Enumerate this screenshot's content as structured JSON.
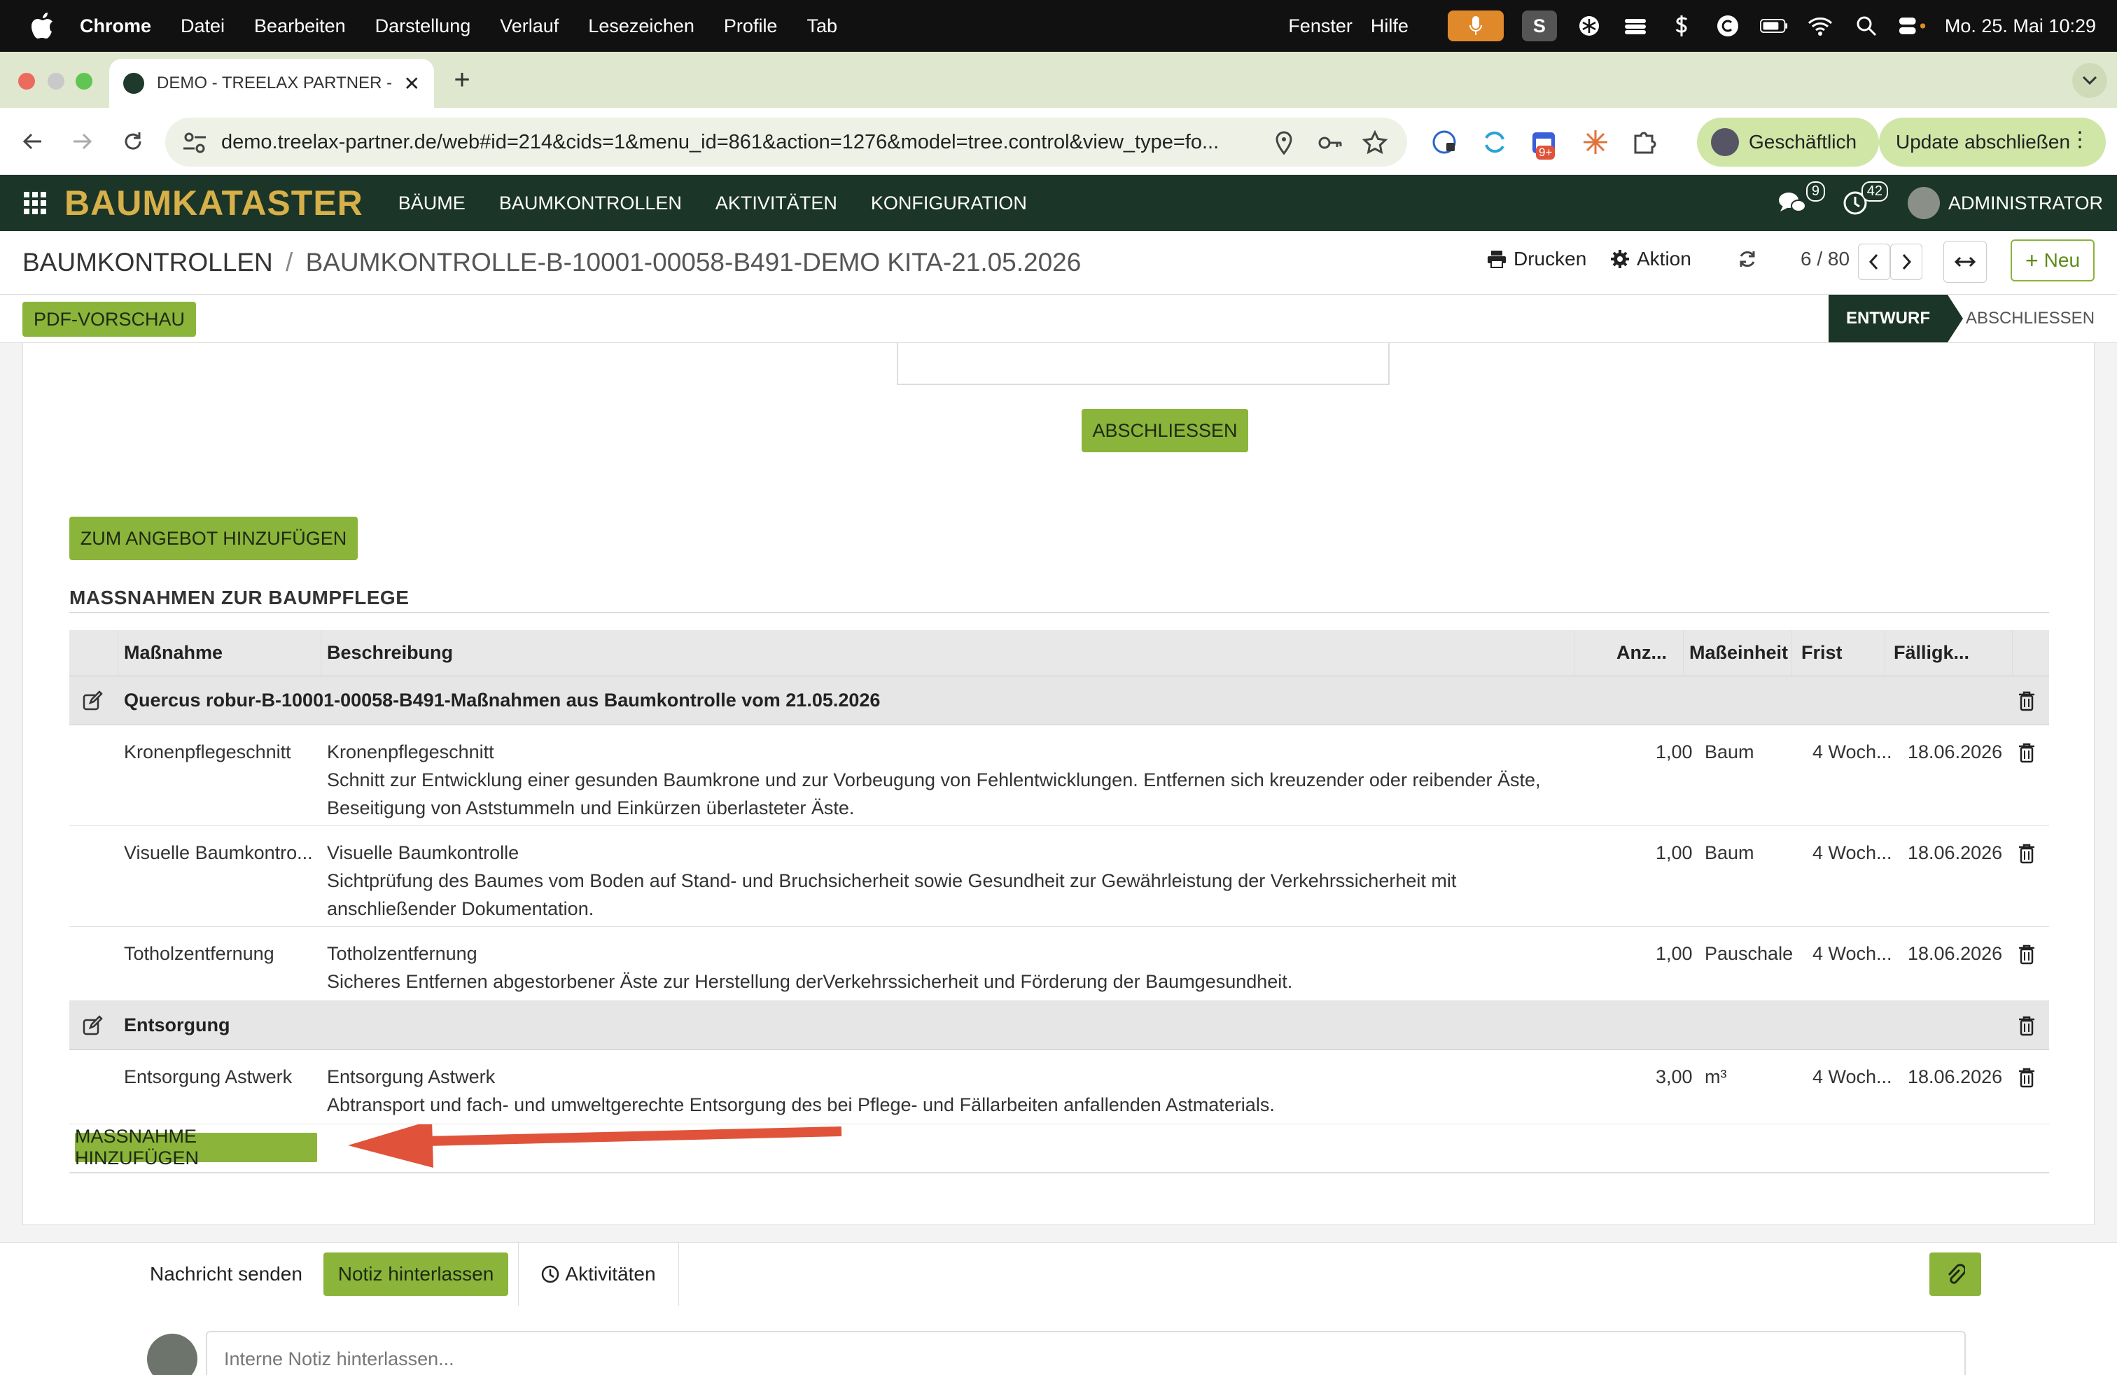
{
  "menubar": {
    "app": "Chrome",
    "items": [
      "Datei",
      "Bearbeiten",
      "Darstellung",
      "Verlauf",
      "Lesezeichen",
      "Profile",
      "Tab"
    ],
    "right_items": [
      "Fenster",
      "Hilfe"
    ],
    "datetime": "Mo. 25. Mai  10:29",
    "s_badge": "S"
  },
  "browser": {
    "tab_title": "DEMO - TREELAX PARTNER -",
    "url": "demo.treelax-partner.de/web#id=214&cids=1&menu_id=861&action=1276&model=tree.control&view_type=fo...",
    "profile_label": "Geschäftlich",
    "update_label": "Update abschließen",
    "ext_badge": "9+"
  },
  "appnav": {
    "brand": "BAUMKATASTER",
    "menus": [
      "BÄUME",
      "BAUMKONTROLLEN",
      "AKTIVITÄTEN",
      "KONFIGURATION"
    ],
    "messages_count": "9",
    "activities_count": "42",
    "user": "ADMINISTRATOR"
  },
  "controlpanel": {
    "breadcrumb_parent": "BAUMKONTROLLEN",
    "breadcrumb_sep": "/",
    "breadcrumb_current": "BAUMKONTROLLE-B-10001-00058-B491-DEMO KITA-21.05.2026",
    "print_label": "Drucken",
    "action_label": "Aktion",
    "pager": "6 / 80",
    "new_label": "Neu"
  },
  "statusbar": {
    "pdf_label": "PDF-VORSCHAU",
    "stages": [
      "ENTWURF",
      "ABSCHLIESSEN"
    ],
    "active_stage": "ENTWURF"
  },
  "form": {
    "finish_label": "ABSCHLIESSEN",
    "add_offer_label": "ZUM ANGEBOT HINZUFÜGEN",
    "section_title": "MASSNAHMEN ZUR BAUMPFLEGE",
    "add_line_label": "MASSNAHME HINZUFÜGEN"
  },
  "table": {
    "headers": [
      "Maßnahme",
      "Beschreibung",
      "Anz...",
      "Maßeinheit",
      "Frist",
      "Fälligk..."
    ],
    "sections": [
      {
        "title": "Quercus robur-B-10001-00058-B491-Maßnahmen aus Baumkontrolle vom 21.05.2026",
        "rows": [
          {
            "measure": "Kronenpflegeschnitt",
            "desc_title": "Kronenpflegeschnitt",
            "desc_line1": "Schnitt zur Entwicklung einer gesunden Baumkrone und zur Vorbeugung von Fehlentwicklungen. Entfernen sich kreuzender oder reibender Äste,",
            "desc_line2": "Beseitigung von Aststummeln und Einkürzen überlasteter Äste.",
            "qty": "1,00",
            "unit": "Baum",
            "deadline": "4 Woch...",
            "due": "18.06.2026"
          },
          {
            "measure": "Visuelle Baumkontro...",
            "desc_title": "Visuelle Baumkontrolle",
            "desc_line1": "Sichtprüfung des Baumes vom Boden auf Stand- und Bruchsicherheit sowie Gesundheit zur Gewährleistung der Verkehrssicherheit mit",
            "desc_line2": "anschließender Dokumentation.",
            "qty": "1,00",
            "unit": "Baum",
            "deadline": "4 Woch...",
            "due": "18.06.2026"
          },
          {
            "measure": "Totholzentfernung",
            "desc_title": "Totholzentfernung",
            "desc_line1": "Sicheres Entfernen abgestorbener Äste zur Herstellung derVerkehrssicherheit und Förderung der Baumgesundheit.",
            "desc_line2": "",
            "qty": "1,00",
            "unit": "Pauschale",
            "deadline": "4 Woch...",
            "due": "18.06.2026"
          }
        ]
      },
      {
        "title": "Entsorgung",
        "rows": [
          {
            "measure": "Entsorgung Astwerk",
            "desc_title": "Entsorgung Astwerk",
            "desc_line1": "Abtransport und fach- und umweltgerechte Entsorgung des bei Pflege- und Fällarbeiten anfallenden Astmaterials.",
            "desc_line2": "",
            "qty": "3,00",
            "unit": "m³",
            "deadline": "4 Woch...",
            "due": "18.06.2026"
          }
        ]
      }
    ]
  },
  "chatter": {
    "send_message": "Nachricht senden",
    "log_note": "Notiz hinterlassen",
    "activities": "Aktivitäten",
    "note_placeholder": "Interne Notiz hinterlassen..."
  },
  "colors": {
    "brand_green": "#1b3528",
    "accent_lime": "#8bb43b",
    "brand_gold": "#d7b04a",
    "annotation_arrow": "#e0533a"
  }
}
